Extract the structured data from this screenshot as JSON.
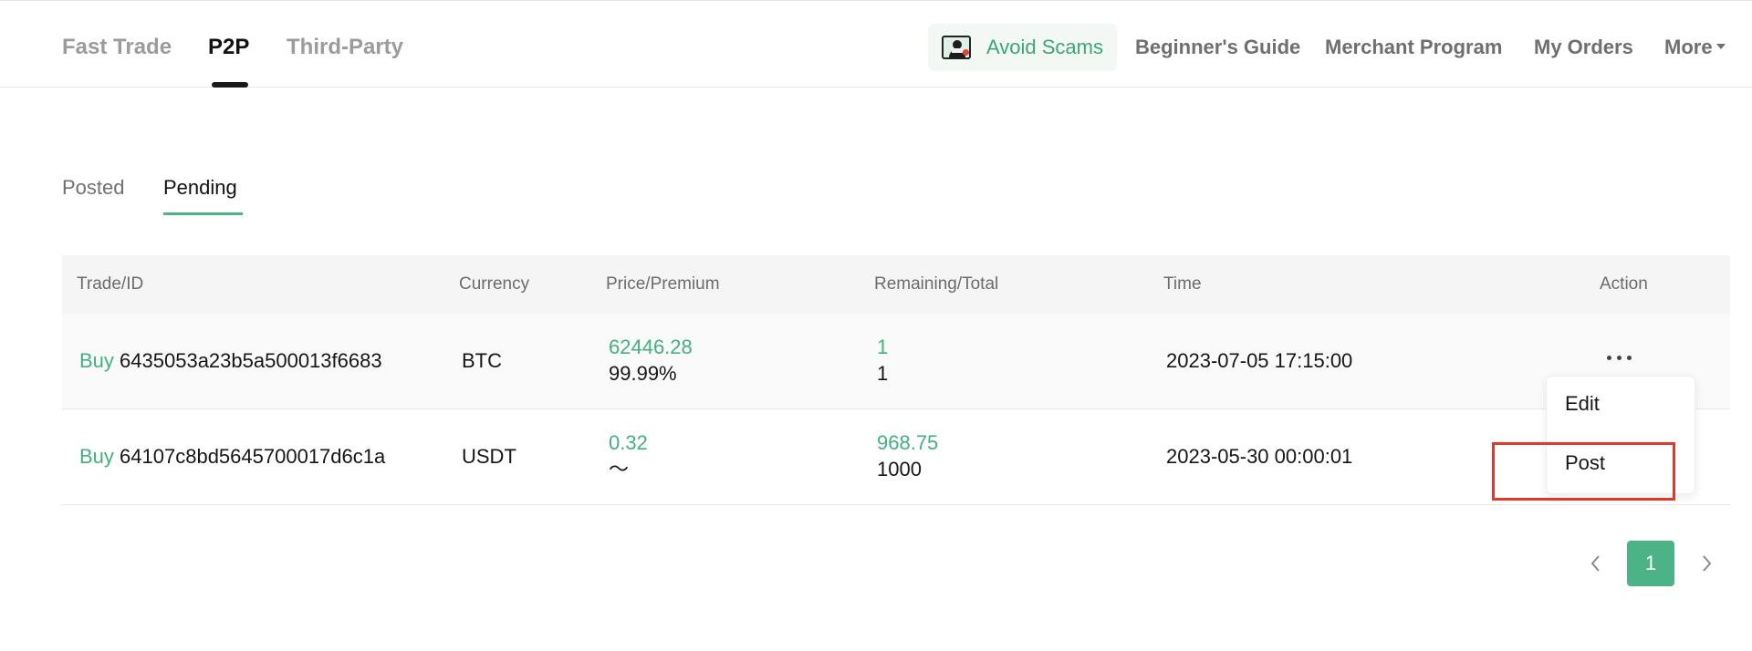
{
  "header": {
    "tabs": [
      {
        "label": "Fast Trade",
        "active": false
      },
      {
        "label": "P2P",
        "active": true
      },
      {
        "label": "Third-Party",
        "active": false
      }
    ],
    "avoid_scams": {
      "label": "Avoid Scams",
      "icon": "scammer-warning-icon"
    },
    "links": [
      {
        "label": "Beginner's Guide"
      },
      {
        "label": "Merchant Program"
      },
      {
        "label": "My Orders"
      },
      {
        "label": "More",
        "icon": "caret-down-icon"
      }
    ]
  },
  "subtabs": [
    {
      "label": "Posted",
      "active": false
    },
    {
      "label": "Pending",
      "active": true
    }
  ],
  "table": {
    "columns": [
      "Trade/ID",
      "Currency",
      "Price/Premium",
      "Remaining/Total",
      "Time",
      "Action"
    ],
    "rows": [
      {
        "side": "Buy",
        "id": "6435053a23b5a500013f6683",
        "currency": "BTC",
        "price": "62446.28",
        "premium": "99.99%",
        "remaining": "1",
        "total": "1",
        "time": "2023-07-05 17:15:00",
        "action_icon": "more-dots-icon"
      },
      {
        "side": "Buy",
        "id": "64107c8bd5645700017d6c1a",
        "currency": "USDT",
        "price": "0.32",
        "premium": "～",
        "remaining": "968.75",
        "total": "1000",
        "time": "2023-05-30 00:00:01"
      }
    ]
  },
  "action_menu": {
    "items": [
      "Edit",
      "Post"
    ],
    "highlighted": "Post"
  },
  "pagination": {
    "current": "1",
    "prev_icon": "chevron-left-icon",
    "next_icon": "chevron-right-icon"
  },
  "colors": {
    "accent": "#4cb387",
    "accent_text": "#43b07f",
    "highlight": "#e0382b"
  }
}
